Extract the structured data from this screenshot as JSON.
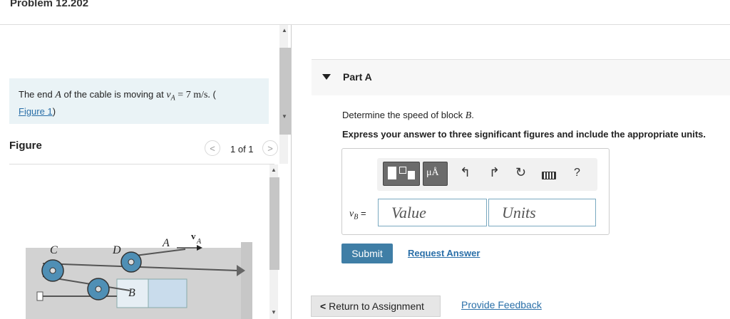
{
  "header": {
    "title": "Problem 12.202"
  },
  "problem": {
    "intro_prefix": "The end",
    "intro_var": "A",
    "intro_mid": "of the cable is moving at",
    "intro_v": "v",
    "intro_vsub": "A",
    "intro_eq": "= 7 m/s.",
    "intro_open": "(",
    "figure_link": "Figure 1",
    "intro_close": ")"
  },
  "figure": {
    "label": "Figure",
    "pager": "1 of 1",
    "prev_icon": "chevron-left-icon",
    "next_icon": "chevron-right-icon",
    "labels": {
      "c": "C",
      "d": "D",
      "a": "A",
      "va": "v",
      "va_sub": "A",
      "b": "B"
    }
  },
  "part": {
    "label": "Part A",
    "question_prefix": "Determine the speed of block",
    "question_var": "B",
    "question_suffix": ".",
    "instructions": "Express your answer to three significant figures and include the appropriate units."
  },
  "answer": {
    "var": "v",
    "var_sub": "B",
    "eq": "=",
    "value_placeholder": "Value",
    "units_placeholder": "Units",
    "toolbar": {
      "mu_a": "μÅ",
      "help": "?"
    }
  },
  "actions": {
    "submit": "Submit",
    "request_answer": "Request Answer",
    "return": "Return to Assignment",
    "feedback": "Provide Feedback"
  },
  "colors": {
    "accent": "#3f7ea6",
    "link": "#2a6fa8",
    "intro_bg": "#eaf3f6"
  }
}
